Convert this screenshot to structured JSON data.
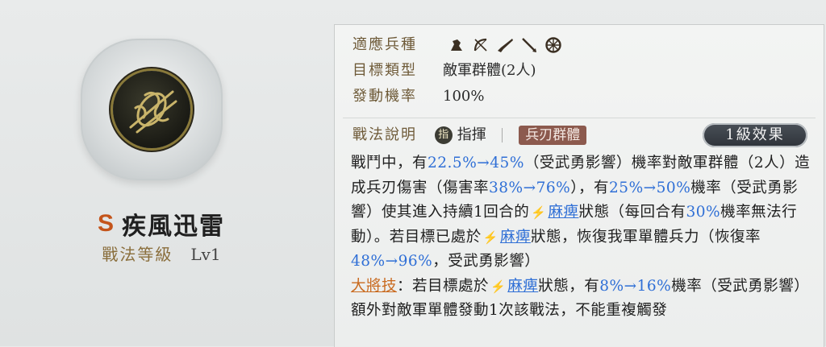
{
  "skill": {
    "grade": "S",
    "name": "疾風迅雷",
    "level_label": "戰法等級",
    "level_value": "Lv1"
  },
  "info": {
    "troop_label": "適應兵種",
    "troop_icons": [
      "cavalry-icon",
      "archer-icon",
      "musket-icon",
      "spear-icon",
      "wheel-icon"
    ],
    "target_label": "目標類型",
    "target_value": "敵軍群體(2人)",
    "rate_label": "發動機率",
    "rate_value": "100%"
  },
  "description": {
    "label": "戰法說明",
    "command_icon": "指",
    "command_label": "指揮",
    "tag": "兵刃群體",
    "effect_button": "1級效果",
    "segments": {
      "t1": "戰鬥中，有",
      "v1": "22.5%→45%",
      "t2": "（受武勇影響）機率對敵軍群體（2人）造成兵刃傷害（傷害率",
      "v2": "38%→76%",
      "t3": "），有",
      "v3": "25%→50%",
      "t4": "機率（受武勇影響）使其進入持續1回合的",
      "s1": "麻痺",
      "t5": "狀態（每回合有",
      "v4": "30%",
      "t6": "機率無法行動）。若目標已處於",
      "s2": "麻痺",
      "t7": "狀態，恢復我軍單體兵力（恢復率",
      "v5": "48%→96%",
      "t8": "，受武勇影響）",
      "general": "大將技",
      "t9": "：若目標處於",
      "s3": "麻痺",
      "t10": "狀態，有",
      "v6": "8%→16%",
      "t11": "機率（受武勇影響）額外對敵軍單體發動1次該戰法，不能重複觸發"
    }
  },
  "colors": {
    "highlight": "#2f6fd6",
    "general": "#c96a1f",
    "grade": "#c4541a"
  }
}
